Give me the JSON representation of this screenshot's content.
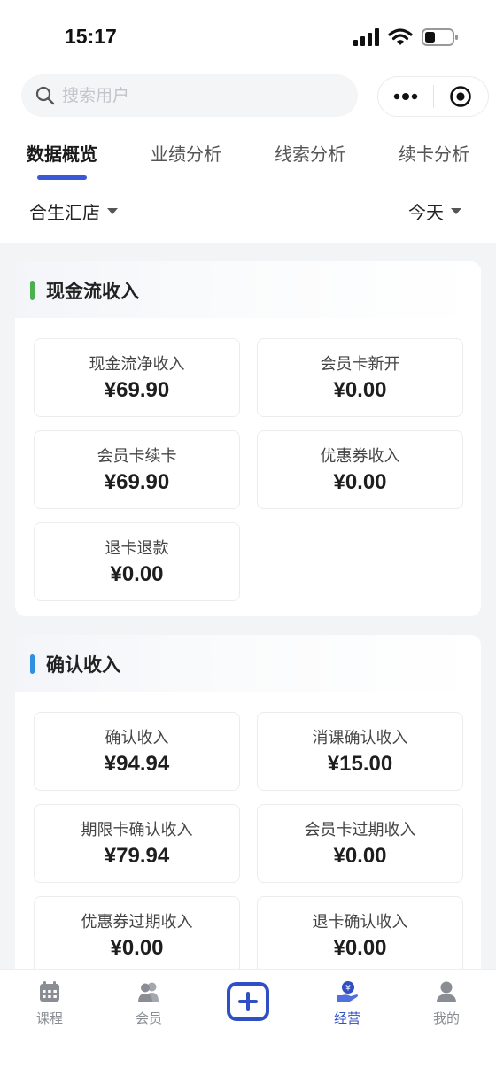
{
  "status_bar": {
    "time": "15:17"
  },
  "search": {
    "placeholder": "搜索用户",
    "value": ""
  },
  "tabs": [
    {
      "label": "数据概览",
      "active": true
    },
    {
      "label": "业绩分析",
      "active": false
    },
    {
      "label": "线索分析",
      "active": false
    },
    {
      "label": "续卡分析",
      "active": false
    }
  ],
  "filters": {
    "store": "合生汇店",
    "period": "今天"
  },
  "sections": [
    {
      "title": "现金流收入",
      "accent": "#4caf50",
      "cards": [
        {
          "label": "现金流净收入",
          "value": "¥69.90"
        },
        {
          "label": "会员卡新开",
          "value": "¥0.00"
        },
        {
          "label": "会员卡续卡",
          "value": "¥69.90"
        },
        {
          "label": "优惠券收入",
          "value": "¥0.00"
        },
        {
          "label": "退卡退款",
          "value": "¥0.00"
        }
      ]
    },
    {
      "title": "确认收入",
      "accent": "#2f8fe0",
      "cards": [
        {
          "label": "确认收入",
          "value": "¥94.94"
        },
        {
          "label": "消课确认收入",
          "value": "¥15.00"
        },
        {
          "label": "期限卡确认收入",
          "value": "¥79.94"
        },
        {
          "label": "会员卡过期收入",
          "value": "¥0.00"
        },
        {
          "label": "优惠券过期收入",
          "value": "¥0.00"
        },
        {
          "label": "退卡确认收入",
          "value": "¥0.00"
        }
      ]
    }
  ],
  "tabbar": [
    {
      "label": "课程",
      "icon": "calendar-icon",
      "active": false
    },
    {
      "label": "会员",
      "icon": "members-icon",
      "active": false
    },
    {
      "label": "",
      "icon": "add-icon",
      "active": false
    },
    {
      "label": "经营",
      "icon": "business-icon",
      "active": true
    },
    {
      "label": "我的",
      "icon": "profile-icon",
      "active": false
    }
  ],
  "colors": {
    "accent_blue": "#3a59d6",
    "tabbar_active": "#2f4fc4",
    "cash_bar": "#4caf50",
    "confirm_bar": "#2f8fe0"
  }
}
